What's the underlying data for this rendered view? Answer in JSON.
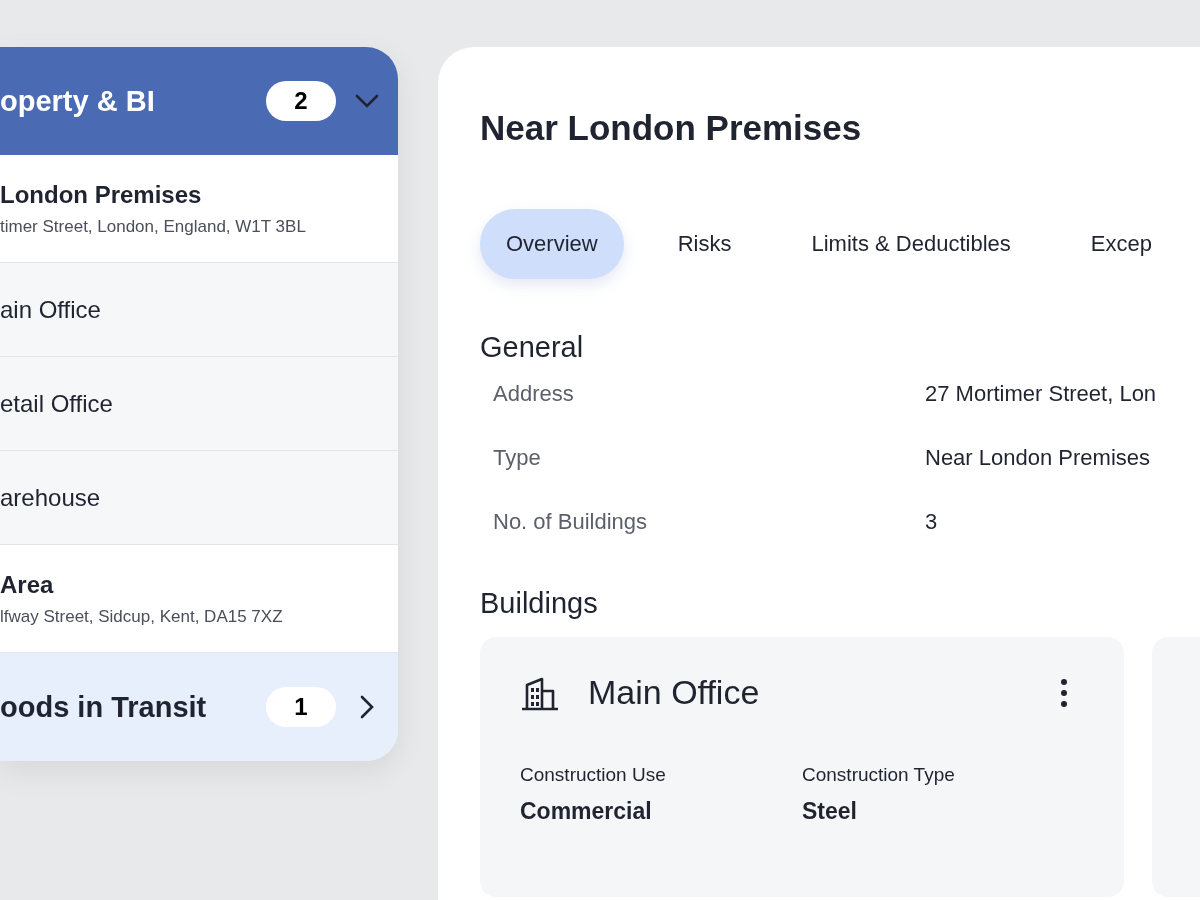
{
  "sidebar": {
    "sections": [
      {
        "title": "operty & BI",
        "count": "2",
        "expanded": true,
        "items": [
          {
            "kind": "location",
            "name": "London Premises",
            "address": "timer Street, London, England, W1T 3BL"
          },
          {
            "kind": "building",
            "name": "ain Office"
          },
          {
            "kind": "building",
            "name": "etail Office"
          },
          {
            "kind": "building",
            "name": "arehouse"
          },
          {
            "kind": "location",
            "name": "Area",
            "address": "lfway Street, Sidcup, Kent, DA15 7XZ"
          }
        ]
      },
      {
        "title": "oods in Transit",
        "count": "1",
        "expanded": false
      }
    ]
  },
  "main": {
    "title": "Near London Premises",
    "tabs": [
      {
        "label": "Overview",
        "selected": true
      },
      {
        "label": "Risks",
        "selected": false
      },
      {
        "label": "Limits & Deductibles",
        "selected": false
      },
      {
        "label": "Excep",
        "selected": false
      }
    ],
    "general": {
      "heading": "General",
      "rows": [
        {
          "label": "Address",
          "value": "27 Mortimer Street, Lon"
        },
        {
          "label": "Type",
          "value": "Near London Premises"
        },
        {
          "label": "No. of Buildings",
          "value": "3"
        }
      ]
    },
    "buildings": {
      "heading": "Buildings",
      "cards": [
        {
          "name": "Main Office",
          "fields": [
            {
              "label": "Construction Use",
              "value": "Commercial"
            },
            {
              "label": "Construction Type",
              "value": "Steel"
            }
          ]
        }
      ]
    }
  }
}
